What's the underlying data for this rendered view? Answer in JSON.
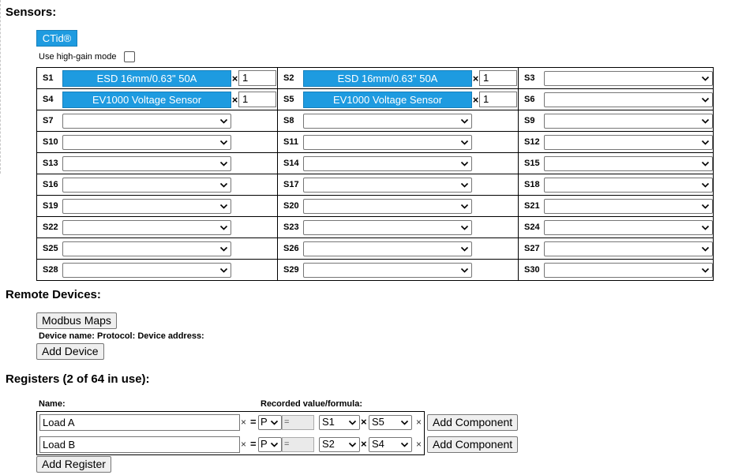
{
  "sections": {
    "sensors_heading": "Sensors:",
    "remote_heading": "Remote Devices:",
    "registers_heading": "Registers (2 of 64 in use):"
  },
  "ctid_button": "CTid®",
  "high_gain_label": "Use high-gain mode",
  "high_gain_checked": false,
  "sensors": [
    {
      "id": "S1",
      "type": "button",
      "label": "ESD 16mm/0.63\" 50A",
      "multiplier": "1"
    },
    {
      "id": "S2",
      "type": "button",
      "label": "ESD 16mm/0.63\" 50A",
      "multiplier": "1"
    },
    {
      "id": "S3",
      "type": "select",
      "label": ""
    },
    {
      "id": "S4",
      "type": "button",
      "label": "EV1000 Voltage Sensor",
      "multiplier": "1"
    },
    {
      "id": "S5",
      "type": "button",
      "label": "EV1000 Voltage Sensor",
      "multiplier": "1"
    },
    {
      "id": "S6",
      "type": "select",
      "label": ""
    },
    {
      "id": "S7",
      "type": "select",
      "label": ""
    },
    {
      "id": "S8",
      "type": "select",
      "label": ""
    },
    {
      "id": "S9",
      "type": "select",
      "label": ""
    },
    {
      "id": "S10",
      "type": "select",
      "label": ""
    },
    {
      "id": "S11",
      "type": "select",
      "label": ""
    },
    {
      "id": "S12",
      "type": "select",
      "label": ""
    },
    {
      "id": "S13",
      "type": "select",
      "label": ""
    },
    {
      "id": "S14",
      "type": "select",
      "label": ""
    },
    {
      "id": "S15",
      "type": "select",
      "label": ""
    },
    {
      "id": "S16",
      "type": "select",
      "label": ""
    },
    {
      "id": "S17",
      "type": "select",
      "label": ""
    },
    {
      "id": "S18",
      "type": "select",
      "label": ""
    },
    {
      "id": "S19",
      "type": "select",
      "label": ""
    },
    {
      "id": "S20",
      "type": "select",
      "label": ""
    },
    {
      "id": "S21",
      "type": "select",
      "label": ""
    },
    {
      "id": "S22",
      "type": "select",
      "label": ""
    },
    {
      "id": "S23",
      "type": "select",
      "label": ""
    },
    {
      "id": "S24",
      "type": "select",
      "label": ""
    },
    {
      "id": "S25",
      "type": "select",
      "label": ""
    },
    {
      "id": "S26",
      "type": "select",
      "label": ""
    },
    {
      "id": "S27",
      "type": "select",
      "label": ""
    },
    {
      "id": "S28",
      "type": "select",
      "label": ""
    },
    {
      "id": "S29",
      "type": "select",
      "label": ""
    },
    {
      "id": "S30",
      "type": "select",
      "label": ""
    }
  ],
  "remote": {
    "modbus_button": "Modbus Maps",
    "device_name_label": "Device name:",
    "protocol_label": "Protocol:",
    "device_address_label": "Device address:",
    "add_device_button": "Add Device"
  },
  "registers": {
    "name_header": "Name:",
    "formula_header": "Recorded value/formula:",
    "rows": [
      {
        "name": "Load A",
        "unit": "P",
        "equals": "=",
        "sensor_a": "S1",
        "sensor_b": "S5",
        "add_label": "Add Component"
      },
      {
        "name": "Load B",
        "unit": "P",
        "equals": "=",
        "sensor_a": "S2",
        "sensor_b": "S4",
        "add_label": "Add Component"
      }
    ],
    "add_register_button": "Add Register"
  },
  "symbols": {
    "times": "×",
    "remove": "×",
    "eq": "="
  },
  "colors": {
    "accent": "#1e9be0"
  }
}
